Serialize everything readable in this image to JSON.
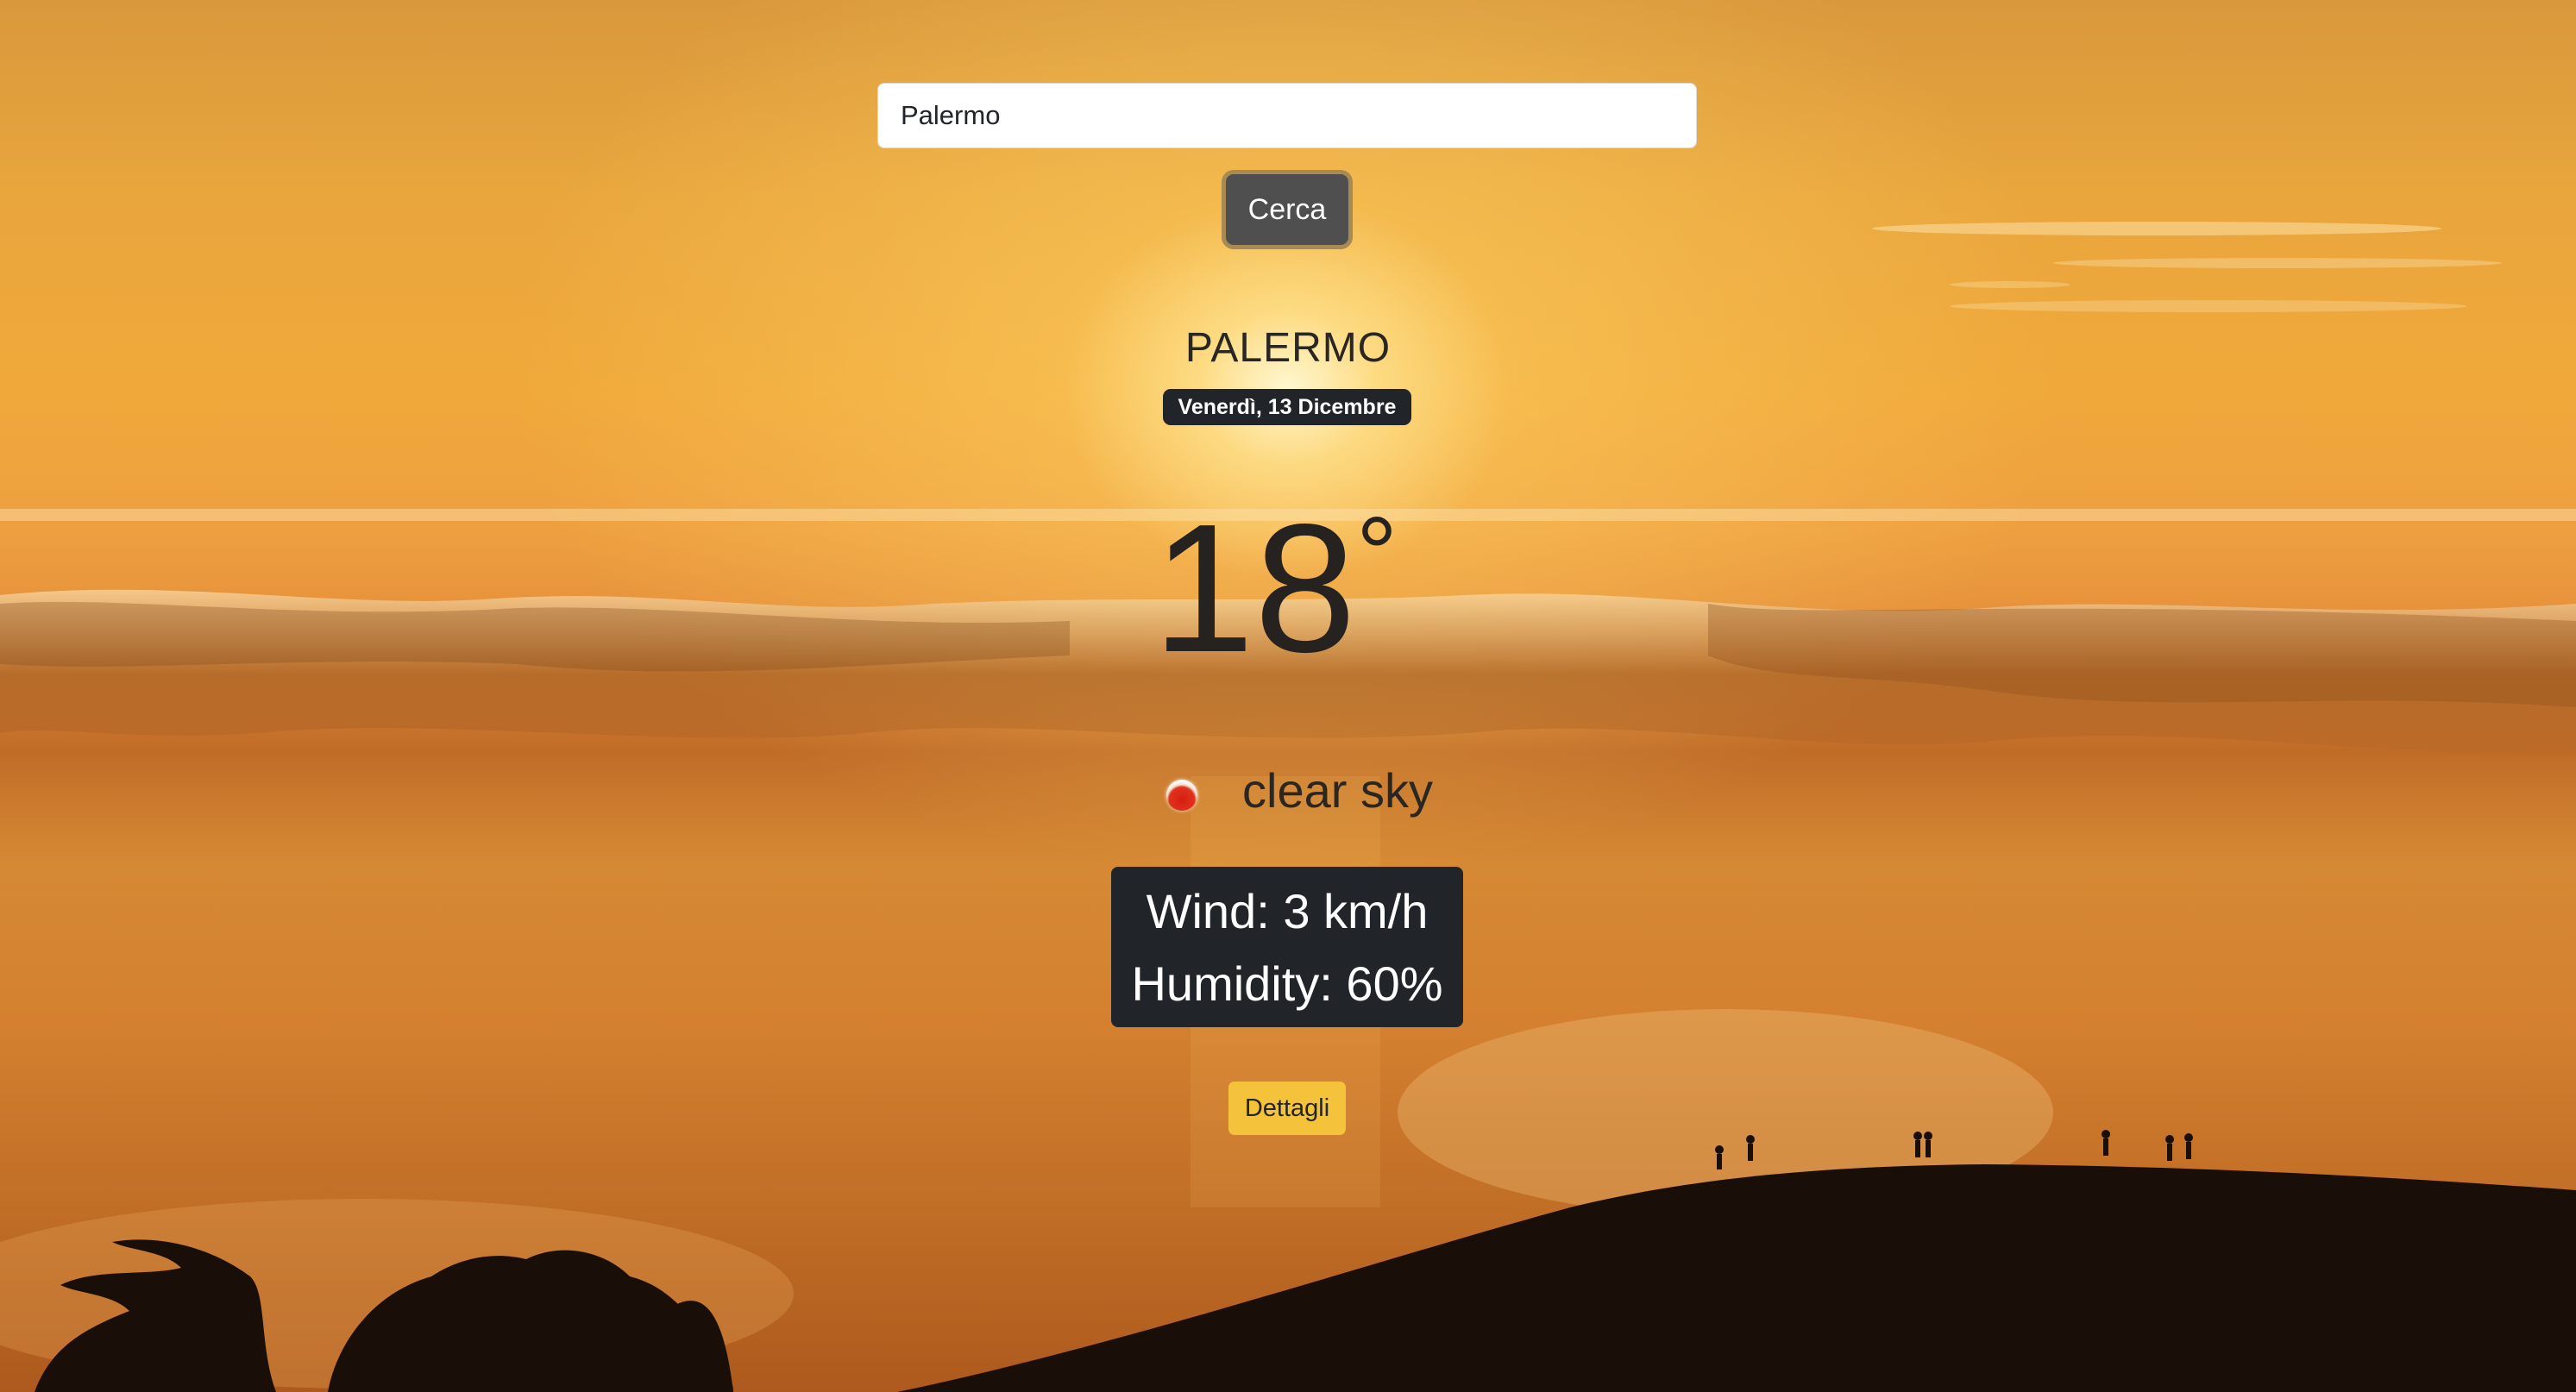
{
  "search": {
    "value": "Palermo",
    "placeholder": ""
  },
  "search_button": "Cerca",
  "city": "PALERMO",
  "date": "Venerdì, 13 Dicembre",
  "temperature": {
    "value": "18",
    "unit": "°"
  },
  "condition": {
    "icon": "clear-sky-icon",
    "text": "clear sky"
  },
  "stats": {
    "wind": "Wind: 3 km/h",
    "humidity": "Humidity: 60%"
  },
  "details_button": "Dettagli",
  "colors": {
    "badge": "#212529",
    "details_button": "#f5c23b",
    "search_button": "#4f4f4f"
  }
}
